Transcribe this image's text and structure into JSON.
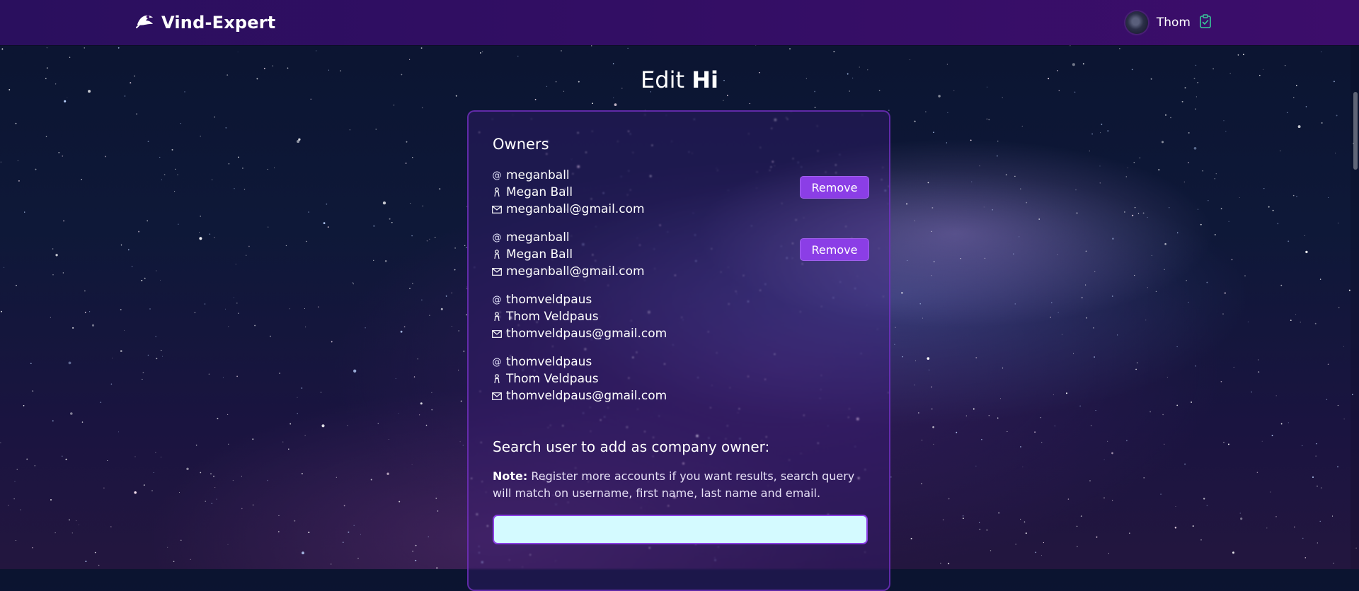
{
  "app": {
    "brand": "Vind-Expert",
    "user_name": "Thom"
  },
  "page": {
    "title_prefix": "Edit",
    "title_name": "Hi"
  },
  "owners": {
    "heading": "Owners",
    "remove_label": "Remove",
    "items": [
      {
        "username": "meganball",
        "name": "Megan Ball",
        "email": "meganball@gmail.com",
        "removable": true
      },
      {
        "username": "meganball",
        "name": "Megan Ball",
        "email": "meganball@gmail.com",
        "removable": true
      },
      {
        "username": "thomveldpaus",
        "name": "Thom Veldpaus",
        "email": "thomveldpaus@gmail.com",
        "removable": false
      },
      {
        "username": "thomveldpaus",
        "name": "Thom Veldpaus",
        "email": "thomveldpaus@gmail.com",
        "removable": false
      }
    ]
  },
  "search": {
    "heading": "Search user to add as company owner:",
    "note_label": "Note:",
    "note_text": " Register more accounts if you want results, search query will match on username, first name, last name and email.",
    "value": "",
    "placeholder": ""
  },
  "colors": {
    "header": "#3c0d6b",
    "accent": "#8b3ee6",
    "input_bg": "#d4faff",
    "clipboard_icon": "#38c99a"
  },
  "icons": [
    "logo-icon",
    "at-icon",
    "user-icon",
    "mail-icon",
    "clipboard-check-icon"
  ]
}
